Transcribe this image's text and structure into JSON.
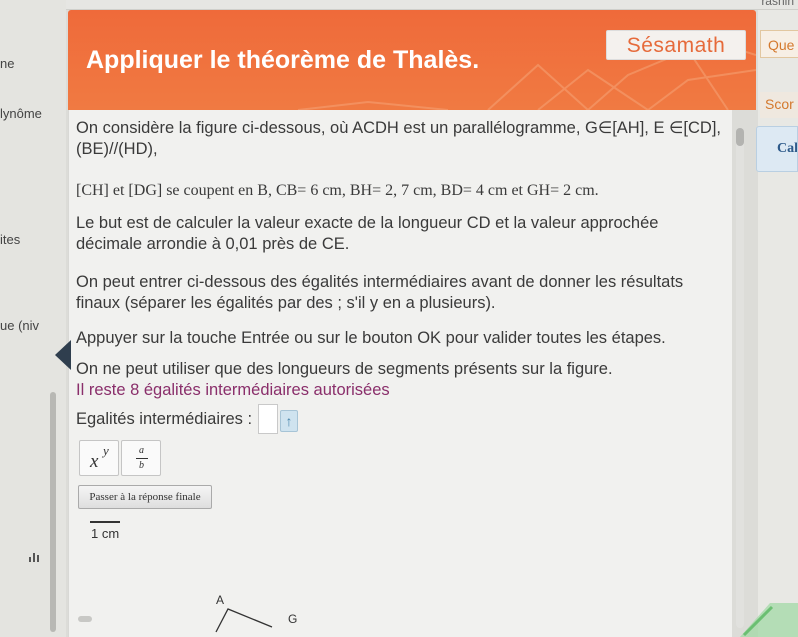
{
  "sidebar": {
    "items": [
      "ne",
      "lynôme",
      "ites",
      "ue (niv"
    ]
  },
  "top_right": "rasnin",
  "banner": {
    "title": "Appliquer le théorème de Thalès.",
    "logo": "Sésamath"
  },
  "right_panel": {
    "que": "Que",
    "score": "Scor",
    "cal": "Cal"
  },
  "exercise": {
    "intro_line1": "On considère la figure ci-dessous, où ACDH est un parallélogramme, G∈[AH], E ∈[CD],",
    "intro_line2": "(BE)//(HD),",
    "data_line": "[CH] et [DG] se coupent en B, CB= 6 cm, BH= 2, 7 cm, BD= 4 cm et GH= 2 cm.",
    "goal_line1": "Le but est de calculer la valeur exacte de la longueur CD et la valeur approchée",
    "goal_line2": "décimale arrondie à 0,01 près de CE.",
    "enter_line1": "On peut entrer ci-dessous des égalités intermédiaires avant de donner les résultats",
    "enter_line2": "finaux (séparer les égalités par des ; s'il y en a plusieurs).",
    "validate": "Appuyer sur la touche Entrée ou sur le bouton OK pour valider toutes les étapes.",
    "constraint": "On ne peut utiliser que des longueurs de segments présents sur la figure.",
    "remaining": "Il reste 8 égalités intermédiaires autorisées",
    "input_label": "Egalités intermédiaires :",
    "input_value": "",
    "arrow_icon": "↑",
    "power_btn": {
      "base": "x",
      "exp": "y"
    },
    "fraction_btn": {
      "num": "a",
      "den": "b"
    },
    "pass_button": "Passer à la réponse finale",
    "scale_label": "1 cm",
    "figure_labels": {
      "A": "A",
      "G": "G"
    }
  },
  "colors": {
    "banner": "#ef6a3a",
    "purple_note": "#8a2f6b",
    "accent_orange": "#d4792d"
  }
}
